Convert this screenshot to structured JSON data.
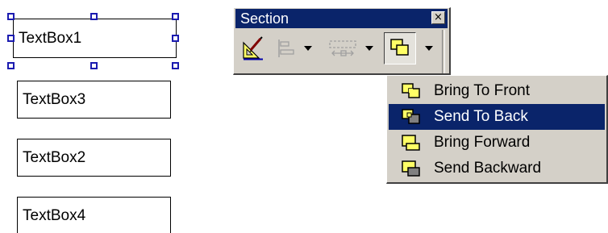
{
  "design_surface": {
    "textboxes": [
      {
        "label": "TextBox1",
        "selected": true
      },
      {
        "label": "TextBox3",
        "selected": false
      },
      {
        "label": "TextBox2",
        "selected": false
      },
      {
        "label": "TextBox4",
        "selected": false
      }
    ]
  },
  "toolbar": {
    "title": "Section",
    "close_glyph": "×",
    "buttons": [
      {
        "icon": "properties-icon",
        "enabled": true
      },
      {
        "icon": "align-icon",
        "enabled": false
      },
      {
        "icon": "size-icon",
        "enabled": false
      },
      {
        "icon": "order-icon",
        "enabled": true,
        "pressed": true
      }
    ]
  },
  "order_menu": {
    "items": [
      {
        "label": "Bring To Front",
        "icon": "bring-to-front-icon",
        "highlighted": false
      },
      {
        "label": "Send To Back",
        "icon": "send-to-back-icon",
        "highlighted": true
      },
      {
        "label": "Bring Forward",
        "icon": "bring-forward-icon",
        "highlighted": false
      },
      {
        "label": "Send Backward",
        "icon": "send-backward-icon",
        "highlighted": false
      }
    ]
  },
  "colors": {
    "title_bar": "#0a246a",
    "face": "#d4d0c8",
    "handle": "#1b1bb0",
    "icon_yellow": "#ffff66"
  }
}
